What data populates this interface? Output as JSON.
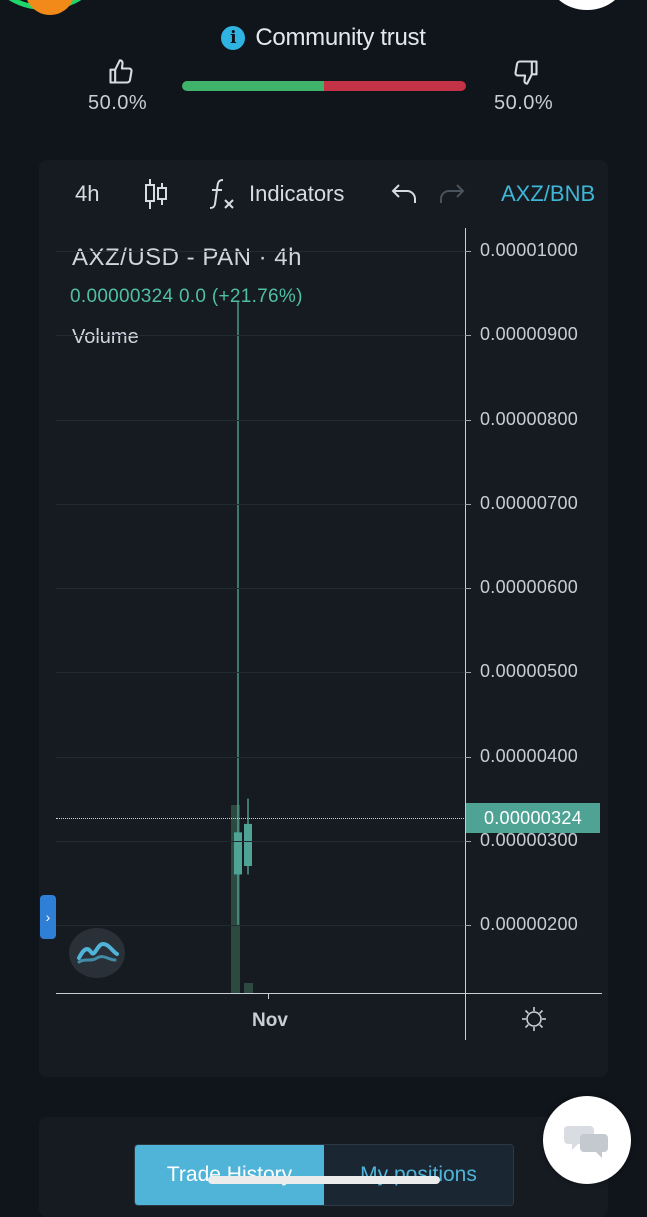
{
  "community_trust": {
    "title": "Community trust",
    "up_percent": "50.0%",
    "down_percent": "50.0%",
    "up_ratio": 0.5
  },
  "toolbar": {
    "interval": "4h",
    "indicators_label": "Indicators",
    "symbol_switch": "AXZ/BNB"
  },
  "chart": {
    "legend_title": "AXZ/USD - PAN · 4h",
    "legend_values": "0.00000324  0.0 (+21.76%)",
    "volume_label": "Volume",
    "current_price_label": "0.00000324",
    "x_label": "Nov",
    "price_labels": [
      "0.00001000",
      "0.00000900",
      "0.00000800",
      "0.00000700",
      "0.00000600",
      "0.00000500",
      "0.00000400",
      "0.00000300",
      "0.00000200"
    ]
  },
  "chart_data": {
    "type": "candlestick",
    "title": "AXZ/USD - PAN · 4h",
    "y_ticks": [
      2e-06,
      3e-06,
      4e-06,
      5e-06,
      6e-06,
      7e-06,
      8e-06,
      9e-06,
      1e-05
    ],
    "current_price": 3.24e-06,
    "change_percent": 21.76,
    "x_ticks": [
      "Nov"
    ],
    "series": [
      {
        "open": 2.6e-06,
        "close": 3.1e-06,
        "high": 9.4e-06,
        "low": 2e-06
      },
      {
        "open": 2.7e-06,
        "close": 3.2e-06,
        "high": 3.5e-06,
        "low": 2.6e-06
      }
    ]
  },
  "tabs": {
    "trade_history": "Trade History",
    "my_positions": "My positions"
  },
  "colors": {
    "accent": "#4fb4d8",
    "up": "#3fb36a",
    "down": "#c43345",
    "price_label_bg": "#4fa394"
  },
  "icons": [
    "info-icon",
    "thumbs-up-icon",
    "thumbs-down-icon",
    "candles-icon",
    "function-icon",
    "undo-icon",
    "redo-icon",
    "gear-icon",
    "chat-icon",
    "tradingview-logo"
  ]
}
